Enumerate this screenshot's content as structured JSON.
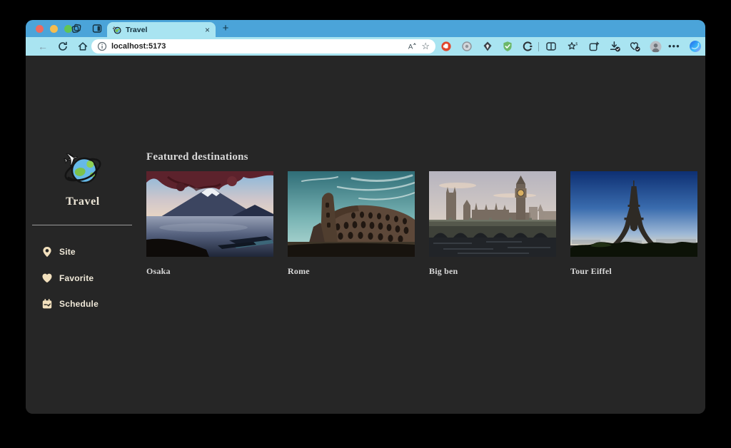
{
  "browser": {
    "tab": {
      "title": "Travel",
      "close_glyph": "×"
    },
    "new_tab_glyph": "+",
    "back_glyph": "←",
    "url": "localhost:5173",
    "star_glyph": "☆",
    "more_glyph": "•••",
    "icons": {
      "left": [
        "workspaces-icon",
        "tab-actions-icon"
      ],
      "toolbar": [
        "back",
        "refresh",
        "home"
      ],
      "address_right": [
        "read-aloud-icon",
        "favorite-star-icon"
      ],
      "extensions": [
        "red-extension-icon",
        "gray-circle-extension-icon",
        "kite-extension-icon",
        "green-shield-extension-icon",
        "c-ring-extension-icon"
      ],
      "builtins": [
        "split-screen-icon",
        "sparkle-star-icon",
        "collections-icon",
        "downloads-icon",
        "browser-essentials-icon",
        "profile-avatar",
        "more-menu",
        "copilot-icon"
      ]
    }
  },
  "sidebar": {
    "title": "Travel",
    "logo": "globe-with-airplane",
    "items": [
      {
        "label": "Site",
        "icon": "location-pin-icon"
      },
      {
        "label": "Favorite",
        "icon": "heart-icon"
      },
      {
        "label": "Schedule",
        "icon": "calendar-check-icon"
      }
    ]
  },
  "main": {
    "heading": "Featured destinations",
    "destinations": [
      {
        "name": "Osaka",
        "image": "mount-fuji-lake-autumn"
      },
      {
        "name": "Rome",
        "image": "colosseum-teal-sky"
      },
      {
        "name": "Big ben",
        "image": "westminster-bridge"
      },
      {
        "name": "Tour Eiffel",
        "image": "eiffel-tower-blue-sky"
      }
    ]
  },
  "colors": {
    "tabstrip": "#4ba4d9",
    "toolbar": "#a9e4f1",
    "page_bg": "#262626",
    "cream_accent": "#f2e0bd",
    "text_light": "#efe8d8"
  }
}
